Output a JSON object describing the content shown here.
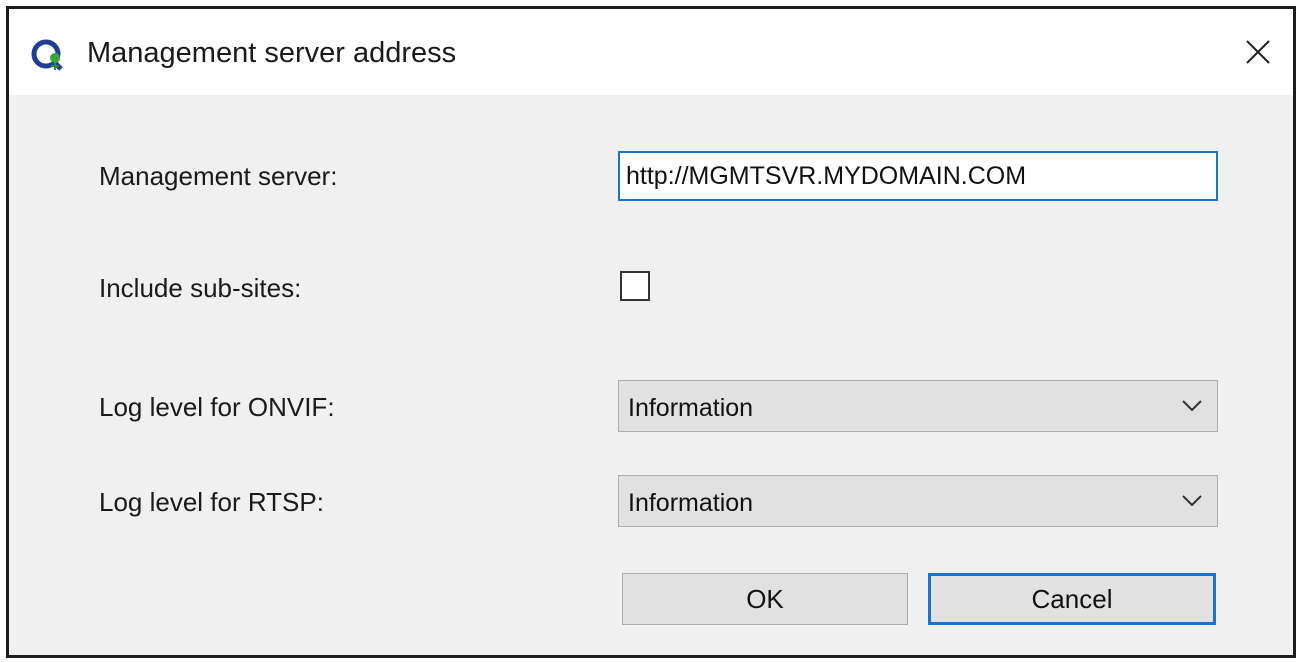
{
  "window": {
    "title": "Management server address",
    "app_icon": "app-logo-icon",
    "close_icon": "close-icon"
  },
  "form": {
    "management_server": {
      "label": "Management server:",
      "value": "http://MGMTSVR.MYDOMAIN.COM"
    },
    "include_subsites": {
      "label": "Include sub-sites:",
      "checked": false
    },
    "onvif_log_level": {
      "label": "Log level for ONVIF:",
      "selected": "Information"
    },
    "rtsp_log_level": {
      "label": "Log level for RTSP:",
      "selected": "Information"
    }
  },
  "buttons": {
    "ok": "OK",
    "cancel": "Cancel"
  },
  "colors": {
    "focus_accent": "#1c73c8",
    "dialog_bg": "#f0f0f0",
    "control_bg": "#e1e1e1"
  }
}
